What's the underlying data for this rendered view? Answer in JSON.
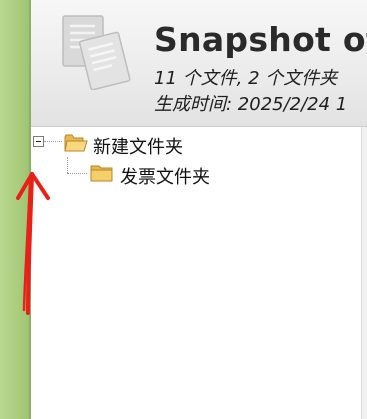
{
  "header": {
    "icon": "documents-icon",
    "title": "Snapshot of C",
    "summary": "11 个文件, 2 个文件夹",
    "generated": "生成时间: 2025/2/24 1"
  },
  "tree": {
    "root": {
      "label": "新建文件夹",
      "icon": "folder-open-icon",
      "expanded": true
    },
    "child": {
      "label": "发票文件夹",
      "icon": "folder-icon"
    }
  },
  "annotation": {
    "icon": "red-arrow-icon",
    "color": "#e8201a"
  }
}
